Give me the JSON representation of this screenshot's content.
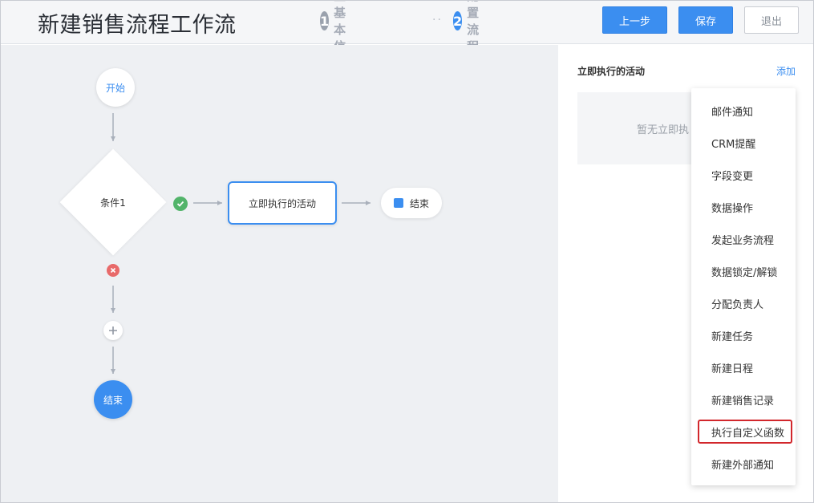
{
  "header": {
    "title": "新建销售流程工作流",
    "steps": [
      {
        "num": "1",
        "label": "配置基本信息"
      },
      {
        "num": "2",
        "label": "配置流程"
      }
    ],
    "step_separator": "··",
    "buttons": {
      "prev": "上一步",
      "save": "保存",
      "exit": "退出"
    }
  },
  "flow": {
    "start": "开始",
    "condition": "条件1",
    "activity": "立即执行的活动",
    "end_right": "结束",
    "end_bottom": "结束",
    "icons": {
      "yes": "check-circle-icon",
      "no": "cross-circle-icon",
      "add": "plus-icon"
    }
  },
  "panel": {
    "title": "立即执行的活动",
    "add_link": "添加",
    "empty_text": "暂无立即执"
  },
  "menu": {
    "items": [
      "邮件通知",
      "CRM提醒",
      "字段变更",
      "数据操作",
      "发起业务流程",
      "数据锁定/解锁",
      "分配负责人",
      "新建任务",
      "新建日程",
      "新建销售记录",
      "执行自定义函数",
      "新建外部通知"
    ],
    "highlighted_index": 10
  },
  "colors": {
    "accent": "#3b8ef0",
    "success": "#52b46a",
    "danger": "#e86a6a",
    "highlight": "#d2272c"
  }
}
